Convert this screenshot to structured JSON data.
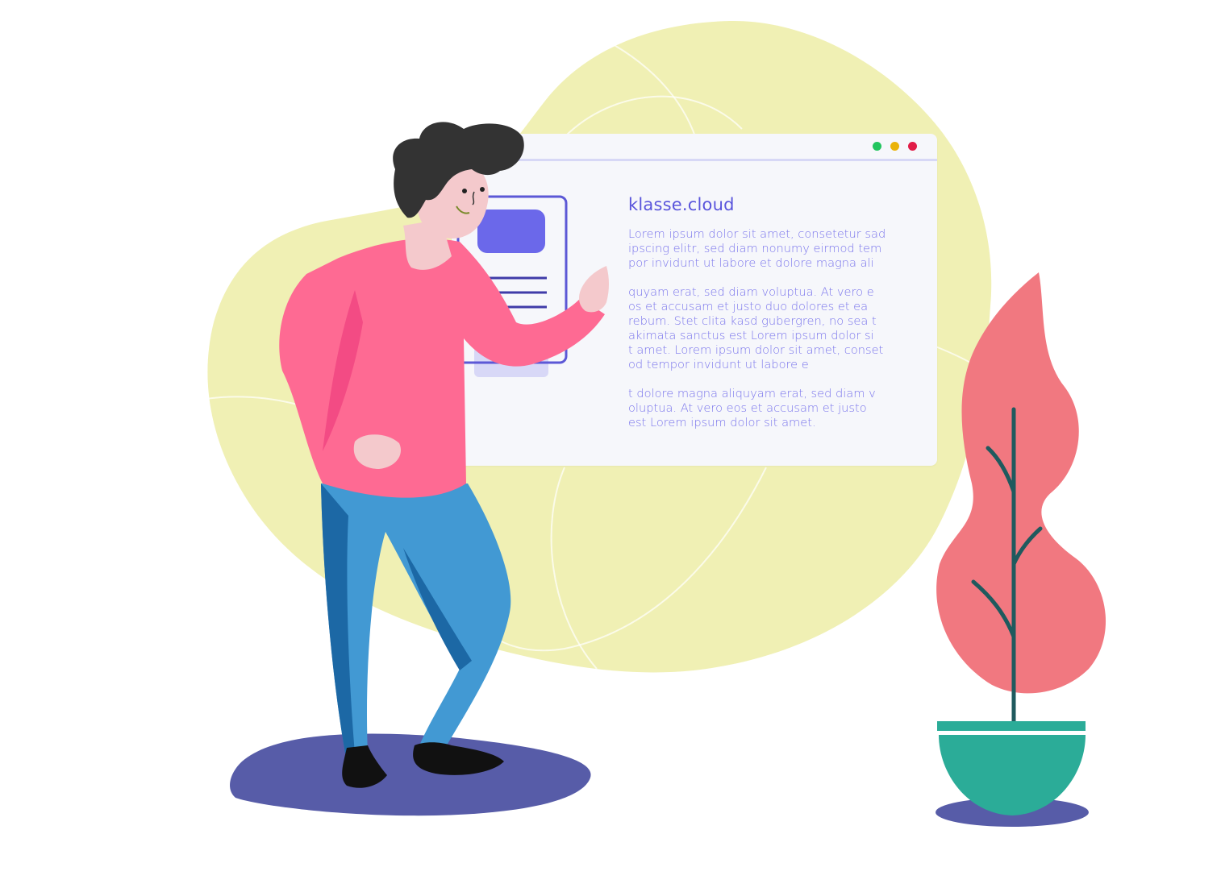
{
  "window": {
    "heading": "klasse.cloud",
    "paragraphs": [
      {
        "lines": [
          "Lorem ipsum dolor sit amet, consetetur sad",
          "ipscing elitr, sed diam nonumy eirmod tem",
          "por invidunt ut labore et dolore magna ali"
        ]
      },
      {
        "lines": [
          "quyam erat, sed diam voluptua. At vero e",
          "os et accusam et justo duo dolores et ea",
          "rebum. Stet clita kasd gubergren, no sea t",
          "akimata sanctus est Lorem ipsum dolor si",
          "t amet. Lorem ipsum dolor sit amet, conset",
          "od tempor invidunt ut labore e"
        ]
      },
      {
        "lines": [
          "t dolore magna aliquyam erat, sed diam v",
          "oluptua. At vero eos et accusam et justo",
          "est Lorem ipsum dolor sit amet."
        ]
      }
    ],
    "window_controls": [
      "green-dot",
      "yellow-dot",
      "red-dot"
    ]
  },
  "colors": {
    "blob": "#f0f0b4",
    "shadow": "#575ca8",
    "shirt": "#fe6a93",
    "pants": "#4299d3",
    "pants_dark": "#1c68a5",
    "skin": "#f4c9cc",
    "hair": "#333333",
    "leaf": "#f17880",
    "stem": "#1f5a5e",
    "pot": "#2bac98",
    "accent": "#6d69ea"
  }
}
